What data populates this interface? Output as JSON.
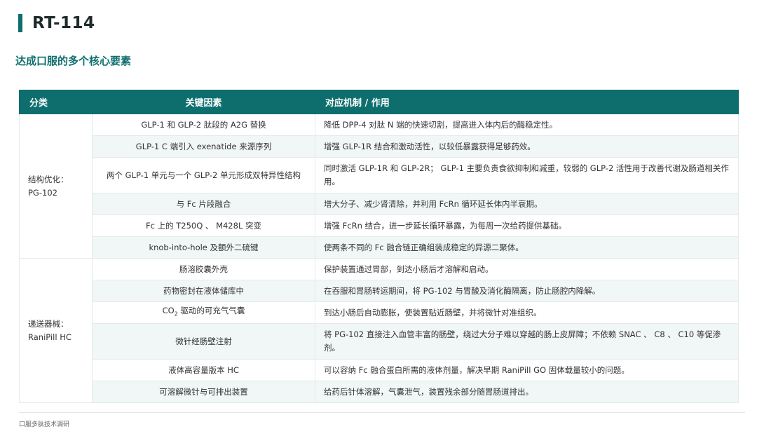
{
  "header": {
    "title": "RT-114",
    "subtitle": "达成口服的多个核心要素"
  },
  "table": {
    "columns": [
      "分类",
      "关键因素",
      "对应机制 / 作用"
    ],
    "groups": [
      {
        "label_line1": "结构优化：",
        "label_line2": "PG-102",
        "rows": [
          {
            "factor": "GLP-1 和 GLP-2 肽段的 A2G 替换",
            "effect": "降低 DPP-4 对肽 N 端的快速切割，提高进入体内后的酶稳定性。"
          },
          {
            "factor": "GLP-1 C 端引入 exenatide 来源序列",
            "effect": "增强 GLP-1R 结合和激动活性，以较低暴露获得足够药效。"
          },
          {
            "factor": "两个 GLP-1 单元与一个 GLP-2 单元形成双特异性结构",
            "effect": "同时激活 GLP-1R 和 GLP-2R； GLP-1 主要负责食欲抑制和减重，较弱的 GLP-2 活性用于改善代谢及肠道相关作用。"
          },
          {
            "factor": "与 Fc 片段融合",
            "effect": "增大分子、减少肾清除，并利用 FcRn 循环延长体内半衰期。"
          },
          {
            "factor": "Fc 上的 T250Q 、 M428L 突变",
            "effect": "增强 FcRn 结合，进一步延长循环暴露，为每周一次给药提供基础。"
          },
          {
            "factor": "knob-into-hole 及额外二硫键",
            "effect": "使两条不同的 Fc 融合链正确组装成稳定的异源二聚体。"
          }
        ]
      },
      {
        "label_line1": "递送器械：",
        "label_line2": "RaniPill HC",
        "rows": [
          {
            "factor": "肠溶胶囊外壳",
            "effect": "保护装置通过胃部，到达小肠后才溶解和启动。"
          },
          {
            "factor": "药物密封在液体储库中",
            "effect": "在吞服和胃肠转运期间，将 PG-102 与胃酸及消化酶隔离，防止肠腔内降解。"
          },
          {
            "factor_prefix": "CO",
            "factor_sub": "2",
            "factor_suffix": " 驱动的可充气气囊",
            "effect": "到达小肠后自动膨胀，使装置贴近肠壁，并将微针对准组织。"
          },
          {
            "factor": "微针经肠壁注射",
            "effect": "将 PG-102 直接注入血管丰富的肠壁，绕过大分子难以穿越的肠上皮屏障；不依赖 SNAC 、 C8 、 C10 等促渗剂。"
          },
          {
            "factor": "液体高容量版本 HC",
            "effect": "可以容纳 Fc 融合蛋白所需的液体剂量，解决早期 RaniPill GO 固体载量较小的问题。"
          },
          {
            "factor": "可溶解微针与可排出装置",
            "effect": "给药后针体溶解，气囊泄气，装置残余部分随胃肠道排出。"
          }
        ]
      }
    ]
  },
  "footer": {
    "text": "口服多肽技术调研"
  },
  "colors": {
    "accent": "#0e6e6e",
    "stripe": "#f1f6f6"
  }
}
